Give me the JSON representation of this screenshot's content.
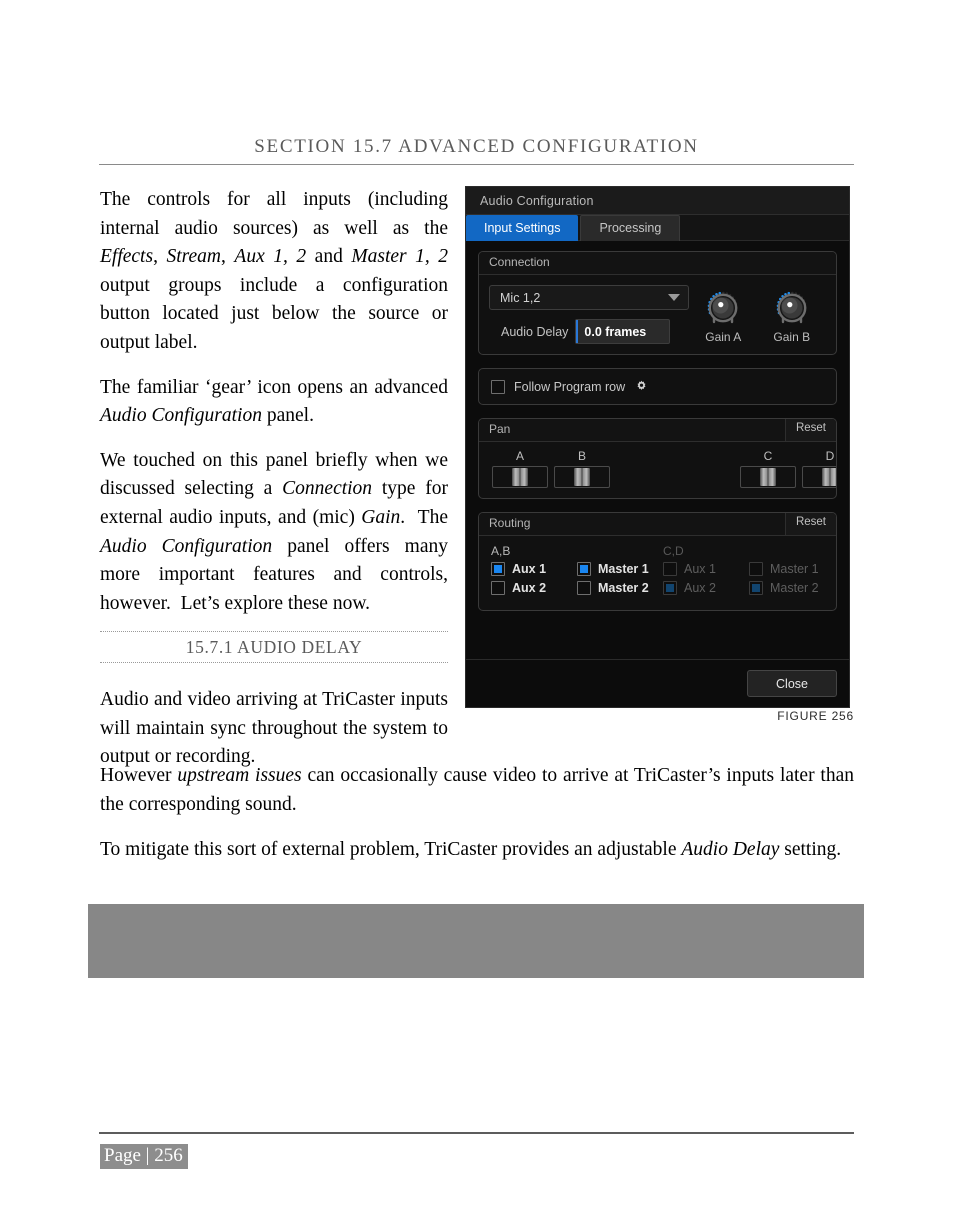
{
  "document": {
    "section_heading": "SECTION 15.7 ADVANCED CONFIGURATION",
    "paragraphs": {
      "p1_html": "The controls for all inputs (including internal audio sources) as well as the <i>Effects</i>, <i>Stream</i>, <i>Aux 1, 2</i> and <i>Master 1, 2</i> output groups include a configuration button located just below the source or output label.",
      "p2_html": "The familiar ‘gear’ icon opens an advanced <i>Audio Configuration</i> panel.",
      "p3_html": "We touched on this panel briefly when we discussed selecting a <i>Connection</i> type for external audio inputs, and (mic) <i>Gain</i>.&nbsp; The <i>Audio Configuration</i> panel offers many more important features and controls, however.&nbsp; Let’s explore these now.",
      "p4_html": "Audio and video arriving at TriCaster inputs will maintain sync throughout the system to output or recording.",
      "p5_html": "However <i>upstream issues</i> can occasionally cause video to arrive at TriCaster’s inputs later than the corresponding sound.",
      "p6_html": "To mitigate this sort of external problem, TriCaster provides an adjustable <i>Audio Delay</i> setting."
    },
    "subsection_heading": "15.7.1 AUDIO DELAY",
    "figure_caption": "FIGURE 256",
    "page_footer": "Page | 256"
  },
  "panel": {
    "title": "Audio Configuration",
    "tabs": [
      {
        "label": "Input Settings",
        "active": true
      },
      {
        "label": "Processing",
        "active": false
      }
    ],
    "connection": {
      "group_title": "Connection",
      "source_select_value": "Mic 1,2",
      "audio_delay_label": "Audio Delay",
      "audio_delay_value": "0.0 frames",
      "knobs": [
        {
          "label": "Gain A"
        },
        {
          "label": "Gain B"
        }
      ]
    },
    "follow": {
      "label": "Follow Program row",
      "checked": false
    },
    "pan": {
      "group_title": "Pan",
      "reset_label": "Reset",
      "channels": [
        {
          "letter": "A",
          "present": true
        },
        {
          "letter": "B",
          "present": true
        },
        {
          "letter": "",
          "present": false
        },
        {
          "letter": "",
          "present": false
        },
        {
          "letter": "C",
          "present": true
        },
        {
          "letter": "D",
          "present": true
        }
      ]
    },
    "routing": {
      "group_title": "Routing",
      "reset_label": "Reset",
      "columns": [
        {
          "title": "A,B",
          "enabled": true,
          "items": [
            {
              "label": "Aux 1",
              "checked": true
            },
            {
              "label": "Master 1",
              "checked": true
            },
            {
              "label": "Aux 2",
              "checked": false
            },
            {
              "label": "Master 2",
              "checked": false
            }
          ]
        },
        {
          "title": "C,D",
          "enabled": false,
          "items": [
            {
              "label": "Aux 1",
              "checked": false
            },
            {
              "label": "Master 1",
              "checked": false
            },
            {
              "label": "Aux 2",
              "checked": true
            },
            {
              "label": "Master 2",
              "checked": true
            }
          ]
        }
      ]
    },
    "close_label": "Close",
    "colors": {
      "accent_blue": "#1268c4",
      "checkbox_on": "#1a86f0",
      "panel_bg": "#0c0c0c",
      "title_bar": "#1b1b1b"
    }
  }
}
